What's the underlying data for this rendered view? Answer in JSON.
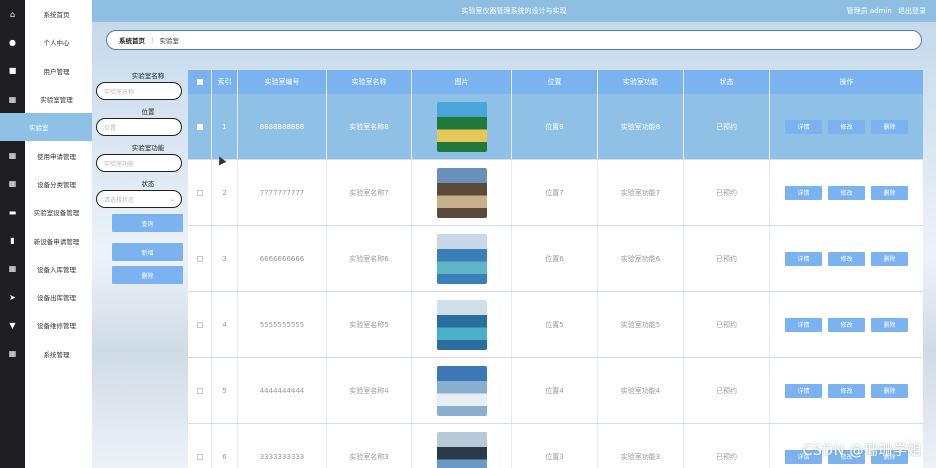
{
  "sidebar": {
    "items": [
      {
        "label": "系统首页",
        "icon": "home-icon",
        "glyph": "⌂"
      },
      {
        "label": "个人中心",
        "icon": "user-icon",
        "glyph": "●"
      },
      {
        "label": "用户管理",
        "icon": "users-icon",
        "glyph": "■"
      },
      {
        "label": "实验室管理",
        "icon": "grid-icon",
        "glyph": "▦"
      },
      {
        "label": "实验室",
        "icon": "",
        "glyph": "",
        "active": true
      },
      {
        "label": "使用申请管理",
        "icon": "grid-icon",
        "glyph": "▦"
      },
      {
        "label": "设备分类管理",
        "icon": "grid-icon",
        "glyph": "▦"
      },
      {
        "label": "实验室设备管理",
        "icon": "monitor-icon",
        "glyph": "▬"
      },
      {
        "label": "新设备申请管理",
        "icon": "chart-icon",
        "glyph": "▮"
      },
      {
        "label": "设备入库管理",
        "icon": "grid-icon",
        "glyph": "▦"
      },
      {
        "label": "设备出库管理",
        "icon": "send-icon",
        "glyph": "➤"
      },
      {
        "label": "设备维修管理",
        "icon": "shield-icon",
        "glyph": "▼"
      },
      {
        "label": "系统管理",
        "icon": "grid-icon",
        "glyph": "▦"
      }
    ]
  },
  "header": {
    "title": "实验室仪器管理系统的设计与实现",
    "user": "管理员 admin",
    "logout": "退出登录"
  },
  "breadcrumb": {
    "home": "系统首页",
    "sep": "⋮",
    "current": "实验室"
  },
  "filters": {
    "name_label": "实验室名称",
    "name_placeholder": "实验室名称",
    "loc_label": "位置",
    "loc_placeholder": "位置",
    "func_label": "实验室功能",
    "func_placeholder": "实验室功能",
    "status_label": "状态",
    "status_placeholder": "请选择状态",
    "query": "查询",
    "add": "新增",
    "delete": "删除"
  },
  "table": {
    "headers": [
      "索引",
      "实验室编号",
      "实验室名称",
      "图片",
      "位置",
      "实验室功能",
      "状态",
      "操作"
    ],
    "actions": {
      "detail": "详情",
      "edit": "修改",
      "delete": "删除"
    },
    "rows": [
      {
        "idx": "1",
        "code": "8888888888",
        "name": "实验室名称8",
        "loc": "位置8",
        "func": "实验室功能8",
        "status": "已预约",
        "selected": true
      },
      {
        "idx": "2",
        "code": "7777777777",
        "name": "实验室名称7",
        "loc": "位置7",
        "func": "实验室功能7",
        "status": "已预约"
      },
      {
        "idx": "3",
        "code": "6666666666",
        "name": "实验室名称6",
        "loc": "位置6",
        "func": "实验室功能6",
        "status": "已预约"
      },
      {
        "idx": "4",
        "code": "5555555555",
        "name": "实验室名称5",
        "loc": "位置5",
        "func": "实验室功能5",
        "status": "已预约"
      },
      {
        "idx": "5",
        "code": "4444444444",
        "name": "实验室名称4",
        "loc": "位置4",
        "func": "实验室功能4",
        "status": "已预约"
      },
      {
        "idx": "6",
        "code": "3333333333",
        "name": "实验室名称3",
        "loc": "位置3",
        "func": "实验室功能3",
        "status": "已预约"
      }
    ]
  },
  "watermark": "CSDN @珊珊学姐",
  "colors": {
    "accent": "#7ab3f0",
    "topbar": "#8ebfe3",
    "selected_row": "#8fc0e6",
    "sidebar_icons_bg": "#1f1f23"
  }
}
